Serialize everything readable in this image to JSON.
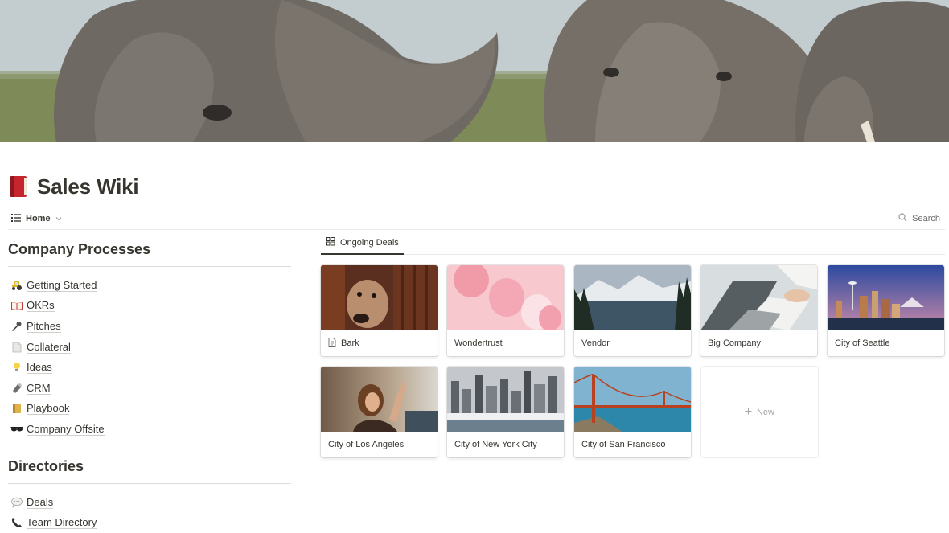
{
  "page": {
    "title": "Sales Wiki",
    "emoji": "red-book-icon"
  },
  "viewbar": {
    "home_label": "Home",
    "search_label": "Search"
  },
  "sections": [
    {
      "heading": "Company Processes",
      "links": [
        {
          "label": "Getting Started",
          "icon": "tractor-icon"
        },
        {
          "label": "OKRs",
          "icon": "open-book-icon"
        },
        {
          "label": "Pitches",
          "icon": "microphone-icon"
        },
        {
          "label": "Collateral",
          "icon": "document-icon"
        },
        {
          "label": "Ideas",
          "icon": "lightbulb-icon"
        },
        {
          "label": "CRM",
          "icon": "flashlight-icon"
        },
        {
          "label": "Playbook",
          "icon": "ledger-icon"
        },
        {
          "label": "Company Offsite",
          "icon": "sunglasses-icon"
        }
      ]
    },
    {
      "heading": "Directories",
      "links": [
        {
          "label": "Deals",
          "icon": "speech-bubble-icon"
        },
        {
          "label": "Team Directory",
          "icon": "telephone-icon"
        }
      ]
    }
  ],
  "gallery": {
    "tab_label": "Ongoing Deals",
    "cards": [
      {
        "title": "Bark",
        "image": "dog-photo"
      },
      {
        "title": "Wondertrust",
        "image": "balloons-photo"
      },
      {
        "title": "Vendor",
        "image": "lake-mountains-photo"
      },
      {
        "title": "Big Company",
        "image": "laptop-desk-photo"
      },
      {
        "title": "City of Seattle",
        "image": "seattle-skyline-photo"
      },
      {
        "title": "City of Los Angeles",
        "image": "woman-portrait-photo"
      },
      {
        "title": "City of New York City",
        "image": "new-york-skyline-photo"
      },
      {
        "title": "City of San Francisco",
        "image": "golden-gate-bridge-photo"
      }
    ],
    "new_label": "New"
  }
}
